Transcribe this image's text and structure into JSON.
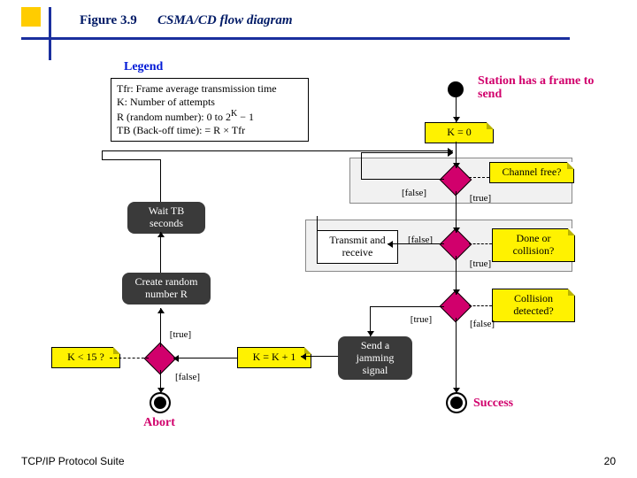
{
  "figure": {
    "number": "Figure 3.9",
    "caption": "CSMA/CD flow diagram"
  },
  "footer": {
    "left": "TCP/IP Protocol Suite",
    "right": "20"
  },
  "legend": {
    "title": "Legend",
    "tfr": "Tfr: Frame average transmission time",
    "k": "K: Number of attempts",
    "r": "R (random number): 0 to 2",
    "rexp": "K",
    "rend": " − 1",
    "tb": "TB (Back-off time): = R × Tfr"
  },
  "nodes": {
    "start_label": "Station has a frame to send",
    "k_init": "K = 0",
    "channel_free": "Channel free?",
    "done_collision": "Done or collision?",
    "collision_detected": "Collision detected?",
    "transmit_receive": "Transmit and receive",
    "send_jamming": "Send a jamming signal",
    "k_inc": "K = K + 1",
    "k_lt_15": "K < 15 ?",
    "wait_tb": "Wait TB seconds",
    "create_random": "Create random number R",
    "abort": "Abort",
    "success": "Success"
  },
  "branch": {
    "true_label": "[true]",
    "false_label": "[false]"
  }
}
